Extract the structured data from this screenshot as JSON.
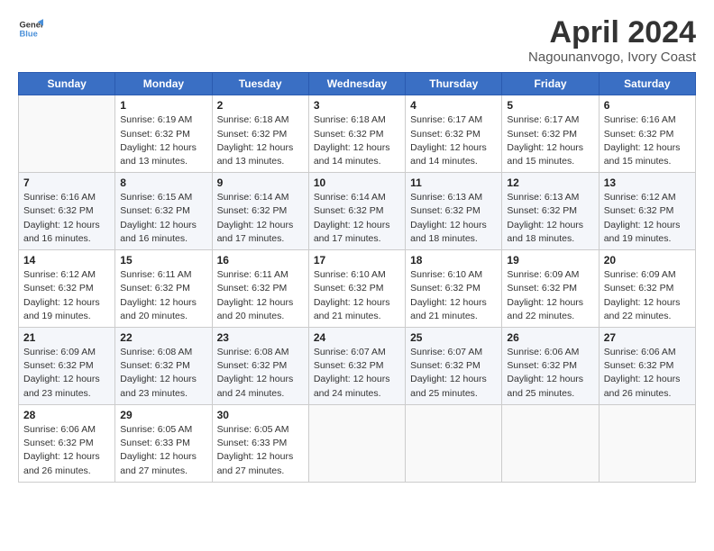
{
  "logo": {
    "line1": "General",
    "line2": "Blue"
  },
  "title": "April 2024",
  "subtitle": "Nagounanvogo, Ivory Coast",
  "header": {
    "days": [
      "Sunday",
      "Monday",
      "Tuesday",
      "Wednesday",
      "Thursday",
      "Friday",
      "Saturday"
    ]
  },
  "weeks": [
    {
      "cells": [
        {
          "day": "",
          "info": ""
        },
        {
          "day": "1",
          "info": "Sunrise: 6:19 AM\nSunset: 6:32 PM\nDaylight: 12 hours\nand 13 minutes."
        },
        {
          "day": "2",
          "info": "Sunrise: 6:18 AM\nSunset: 6:32 PM\nDaylight: 12 hours\nand 13 minutes."
        },
        {
          "day": "3",
          "info": "Sunrise: 6:18 AM\nSunset: 6:32 PM\nDaylight: 12 hours\nand 14 minutes."
        },
        {
          "day": "4",
          "info": "Sunrise: 6:17 AM\nSunset: 6:32 PM\nDaylight: 12 hours\nand 14 minutes."
        },
        {
          "day": "5",
          "info": "Sunrise: 6:17 AM\nSunset: 6:32 PM\nDaylight: 12 hours\nand 15 minutes."
        },
        {
          "day": "6",
          "info": "Sunrise: 6:16 AM\nSunset: 6:32 PM\nDaylight: 12 hours\nand 15 minutes."
        }
      ]
    },
    {
      "cells": [
        {
          "day": "7",
          "info": "Sunrise: 6:16 AM\nSunset: 6:32 PM\nDaylight: 12 hours\nand 16 minutes."
        },
        {
          "day": "8",
          "info": "Sunrise: 6:15 AM\nSunset: 6:32 PM\nDaylight: 12 hours\nand 16 minutes."
        },
        {
          "day": "9",
          "info": "Sunrise: 6:14 AM\nSunset: 6:32 PM\nDaylight: 12 hours\nand 17 minutes."
        },
        {
          "day": "10",
          "info": "Sunrise: 6:14 AM\nSunset: 6:32 PM\nDaylight: 12 hours\nand 17 minutes."
        },
        {
          "day": "11",
          "info": "Sunrise: 6:13 AM\nSunset: 6:32 PM\nDaylight: 12 hours\nand 18 minutes."
        },
        {
          "day": "12",
          "info": "Sunrise: 6:13 AM\nSunset: 6:32 PM\nDaylight: 12 hours\nand 18 minutes."
        },
        {
          "day": "13",
          "info": "Sunrise: 6:12 AM\nSunset: 6:32 PM\nDaylight: 12 hours\nand 19 minutes."
        }
      ]
    },
    {
      "cells": [
        {
          "day": "14",
          "info": "Sunrise: 6:12 AM\nSunset: 6:32 PM\nDaylight: 12 hours\nand 19 minutes."
        },
        {
          "day": "15",
          "info": "Sunrise: 6:11 AM\nSunset: 6:32 PM\nDaylight: 12 hours\nand 20 minutes."
        },
        {
          "day": "16",
          "info": "Sunrise: 6:11 AM\nSunset: 6:32 PM\nDaylight: 12 hours\nand 20 minutes."
        },
        {
          "day": "17",
          "info": "Sunrise: 6:10 AM\nSunset: 6:32 PM\nDaylight: 12 hours\nand 21 minutes."
        },
        {
          "day": "18",
          "info": "Sunrise: 6:10 AM\nSunset: 6:32 PM\nDaylight: 12 hours\nand 21 minutes."
        },
        {
          "day": "19",
          "info": "Sunrise: 6:09 AM\nSunset: 6:32 PM\nDaylight: 12 hours\nand 22 minutes."
        },
        {
          "day": "20",
          "info": "Sunrise: 6:09 AM\nSunset: 6:32 PM\nDaylight: 12 hours\nand 22 minutes."
        }
      ]
    },
    {
      "cells": [
        {
          "day": "21",
          "info": "Sunrise: 6:09 AM\nSunset: 6:32 PM\nDaylight: 12 hours\nand 23 minutes."
        },
        {
          "day": "22",
          "info": "Sunrise: 6:08 AM\nSunset: 6:32 PM\nDaylight: 12 hours\nand 23 minutes."
        },
        {
          "day": "23",
          "info": "Sunrise: 6:08 AM\nSunset: 6:32 PM\nDaylight: 12 hours\nand 24 minutes."
        },
        {
          "day": "24",
          "info": "Sunrise: 6:07 AM\nSunset: 6:32 PM\nDaylight: 12 hours\nand 24 minutes."
        },
        {
          "day": "25",
          "info": "Sunrise: 6:07 AM\nSunset: 6:32 PM\nDaylight: 12 hours\nand 25 minutes."
        },
        {
          "day": "26",
          "info": "Sunrise: 6:06 AM\nSunset: 6:32 PM\nDaylight: 12 hours\nand 25 minutes."
        },
        {
          "day": "27",
          "info": "Sunrise: 6:06 AM\nSunset: 6:32 PM\nDaylight: 12 hours\nand 26 minutes."
        }
      ]
    },
    {
      "cells": [
        {
          "day": "28",
          "info": "Sunrise: 6:06 AM\nSunset: 6:32 PM\nDaylight: 12 hours\nand 26 minutes."
        },
        {
          "day": "29",
          "info": "Sunrise: 6:05 AM\nSunset: 6:33 PM\nDaylight: 12 hours\nand 27 minutes."
        },
        {
          "day": "30",
          "info": "Sunrise: 6:05 AM\nSunset: 6:33 PM\nDaylight: 12 hours\nand 27 minutes."
        },
        {
          "day": "",
          "info": ""
        },
        {
          "day": "",
          "info": ""
        },
        {
          "day": "",
          "info": ""
        },
        {
          "day": "",
          "info": ""
        }
      ]
    }
  ]
}
